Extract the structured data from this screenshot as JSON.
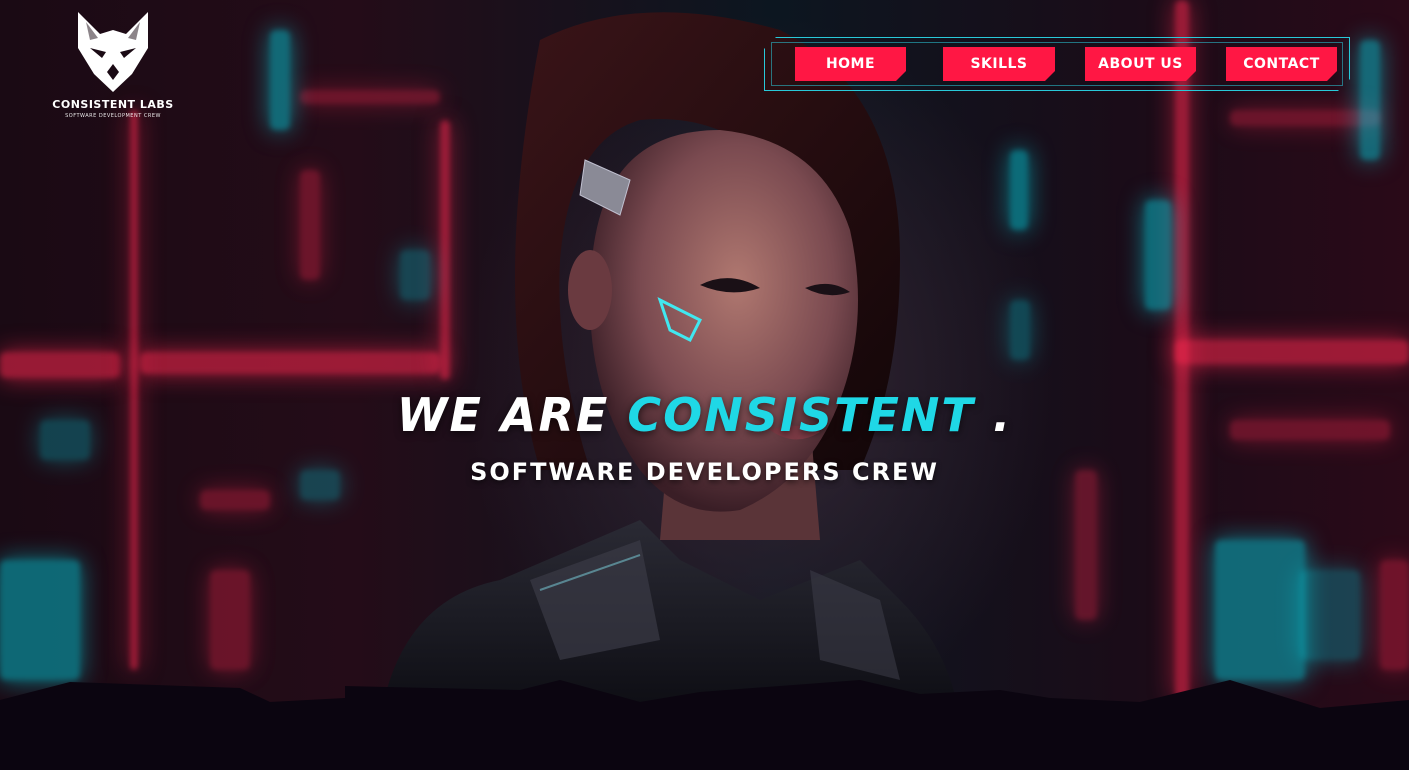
{
  "brand": {
    "name": "CONSISTENT LABS",
    "tagline": "SOFTWARE DEVELOPMENT CREW",
    "logo_icon": "wolf-head-icon"
  },
  "nav": {
    "items": [
      {
        "label": "HOME"
      },
      {
        "label": "SKILLS"
      },
      {
        "label": "ABOUT US"
      },
      {
        "label": "CONTACT"
      }
    ]
  },
  "hero": {
    "title_prefix": "WE ARE",
    "title_accent": "CONSISTENT",
    "title_suffix": ".",
    "subtitle": "SOFTWARE DEVELOPERS CREW",
    "background_image": "cyberpunk-woman-illustration"
  },
  "colors": {
    "accent_red": "#ff1744",
    "accent_cyan": "#1fd8e6",
    "ground": "#0b0510"
  }
}
